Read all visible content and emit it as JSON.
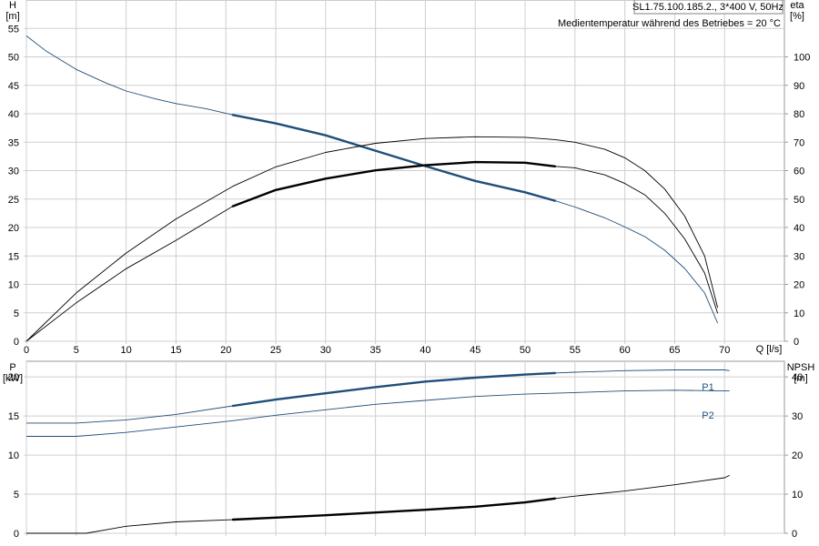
{
  "chart_data": [
    {
      "type": "line",
      "header": "SL1.75.100.185.2., 3*400 V, 50Hz",
      "note": "Medientemperatur während des Betriebes = 20 °C",
      "x_axis": {
        "label": "Q [l/s]",
        "range": [
          0,
          76
        ],
        "ticks": [
          0,
          5,
          10,
          15,
          20,
          25,
          30,
          35,
          40,
          45,
          50,
          55,
          60,
          65,
          70
        ]
      },
      "y_left": {
        "label": "H",
        "unit": "[m]",
        "range": [
          0,
          60
        ],
        "ticks": [
          0,
          5,
          10,
          15,
          20,
          25,
          30,
          35,
          40,
          45,
          50,
          55
        ]
      },
      "y_right": {
        "label": "eta",
        "unit": "[%]",
        "range": [
          0,
          120
        ],
        "ticks": [
          0,
          10,
          20,
          30,
          40,
          50,
          60,
          70,
          80,
          90,
          100
        ]
      },
      "grid": true,
      "series": [
        {
          "axis": "left",
          "color": "#1f4e79",
          "points": [
            [
              0,
              53.7
            ],
            [
              2,
              51
            ],
            [
              5,
              47.8
            ],
            [
              8,
              45.4
            ],
            [
              10,
              44
            ],
            [
              13,
              42.6
            ],
            [
              15,
              41.8
            ],
            [
              18,
              40.9
            ],
            [
              20.7,
              39.8
            ],
            [
              25,
              38.3
            ],
            [
              30,
              36.2
            ],
            [
              35,
              33.5
            ],
            [
              40,
              30.8
            ],
            [
              45,
              28.2
            ],
            [
              50,
              26.2
            ],
            [
              53,
              24.7
            ],
            [
              55,
              23.6
            ],
            [
              58,
              21.7
            ],
            [
              60,
              20.1
            ],
            [
              62,
              18.4
            ],
            [
              64,
              16
            ],
            [
              66,
              12.8
            ],
            [
              68,
              8.5
            ],
            [
              69.3,
              3.2
            ]
          ],
          "highlight": [
            20.7,
            53
          ]
        },
        {
          "axis": "right",
          "color": "#000000",
          "points": [
            [
              0,
              0
            ],
            [
              5,
              13.5
            ],
            [
              10,
              25.5
            ],
            [
              15,
              35.5
            ],
            [
              20.7,
              47.5
            ],
            [
              25,
              53.2
            ],
            [
              30,
              57.2
            ],
            [
              35,
              60.1
            ],
            [
              40,
              61.9
            ],
            [
              45,
              63
            ],
            [
              50,
              62.8
            ],
            [
              53,
              61.5
            ],
            [
              55,
              61
            ],
            [
              58,
              58.5
            ],
            [
              60,
              55.5
            ],
            [
              62,
              51.5
            ],
            [
              64,
              45
            ],
            [
              66,
              36
            ],
            [
              68,
              24
            ],
            [
              69.3,
              9.8
            ]
          ],
          "highlight": [
            20.7,
            53
          ]
        },
        {
          "axis": "right",
          "color": "#000000",
          "points": [
            [
              0,
              0
            ],
            [
              5,
              17
            ],
            [
              10,
              31
            ],
            [
              15,
              43
            ],
            [
              20.7,
              54.5
            ],
            [
              25,
              61.3
            ],
            [
              30,
              66.4
            ],
            [
              35,
              69.6
            ],
            [
              40,
              71.3
            ],
            [
              45,
              71.9
            ],
            [
              50,
              71.7
            ],
            [
              53,
              70.9
            ],
            [
              55,
              70
            ],
            [
              58,
              67.5
            ],
            [
              60,
              64.5
            ],
            [
              62,
              60
            ],
            [
              64,
              53.5
            ],
            [
              66,
              44
            ],
            [
              68,
              30
            ],
            [
              69.3,
              11.8
            ]
          ],
          "highlight": []
        }
      ]
    },
    {
      "type": "line",
      "x_axis": {
        "range": [
          0,
          76
        ],
        "ticks": [
          0,
          5,
          10,
          15,
          20,
          25,
          30,
          35,
          40,
          45,
          50,
          55,
          60,
          65,
          70
        ]
      },
      "y_left": {
        "label": "P",
        "unit": "[kW]",
        "range": [
          0,
          22
        ],
        "ticks": [
          0,
          5,
          10,
          15,
          20
        ]
      },
      "y_right": {
        "label": "NPSH",
        "unit": "[m]",
        "range": [
          0,
          44
        ],
        "ticks": [
          0,
          10,
          20,
          30,
          40
        ]
      },
      "grid": true,
      "series": [
        {
          "name": "P1",
          "axis": "left",
          "color": "#1f4e79",
          "points": [
            [
              0,
              14.1
            ],
            [
              5,
              14.1
            ],
            [
              10,
              14.5
            ],
            [
              15,
              15.2
            ],
            [
              20.7,
              16.3
            ],
            [
              25,
              17.1
            ],
            [
              30,
              17.9
            ],
            [
              35,
              18.7
            ],
            [
              40,
              19.4
            ],
            [
              45,
              19.9
            ],
            [
              50,
              20.3
            ],
            [
              53,
              20.5
            ],
            [
              55,
              20.6
            ],
            [
              60,
              20.8
            ],
            [
              65,
              20.9
            ],
            [
              70,
              20.9
            ],
            [
              70.5,
              20.8
            ]
          ],
          "highlight": [
            20.7,
            53
          ]
        },
        {
          "name": "P2",
          "axis": "left",
          "color": "#1f4e79",
          "points": [
            [
              0,
              12.4
            ],
            [
              5,
              12.4
            ],
            [
              10,
              12.9
            ],
            [
              15,
              13.6
            ],
            [
              20.7,
              14.4
            ],
            [
              25,
              15.1
            ],
            [
              30,
              15.8
            ],
            [
              35,
              16.5
            ],
            [
              40,
              17.0
            ],
            [
              45,
              17.5
            ],
            [
              50,
              17.8
            ],
            [
              55,
              18.0
            ],
            [
              60,
              18.2
            ],
            [
              65,
              18.3
            ],
            [
              70,
              18.2
            ],
            [
              70.5,
              18.2
            ]
          ],
          "highlight": []
        },
        {
          "axis": "right",
          "color": "#000000",
          "points": [
            [
              0,
              0
            ],
            [
              6,
              0
            ],
            [
              10,
              1.8
            ],
            [
              15,
              2.9
            ],
            [
              20.7,
              3.5
            ],
            [
              25,
              4.0
            ],
            [
              30,
              4.6
            ],
            [
              35,
              5.3
            ],
            [
              40,
              6.0
            ],
            [
              45,
              6.8
            ],
            [
              50,
              7.9
            ],
            [
              53,
              8.9
            ],
            [
              55,
              9.5
            ],
            [
              60,
              10.8
            ],
            [
              65,
              12.4
            ],
            [
              70,
              14.2
            ],
            [
              70.5,
              14.8
            ]
          ],
          "highlight": [
            20.7,
            53
          ]
        }
      ]
    }
  ]
}
